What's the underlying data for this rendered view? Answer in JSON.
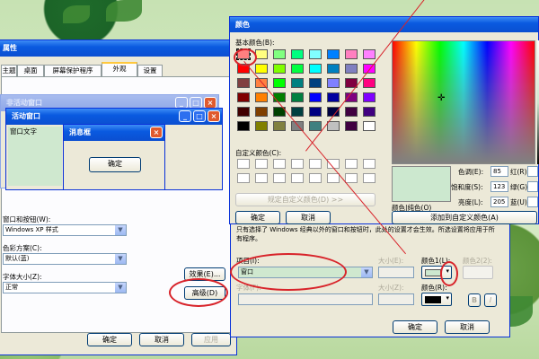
{
  "props_window": {
    "title": "属性",
    "tabs": [
      "主题",
      "桌面",
      "屏幕保护程序",
      "外观",
      "设置"
    ],
    "labels": {
      "window_buttons": "窗口和按钮(W):",
      "color_scheme": "色彩方案(C):",
      "font_size": "字体大小(Z):"
    },
    "values": {
      "window_buttons": "Windows XP 样式",
      "color_scheme": "默认(蓝)",
      "font_size": "正常"
    },
    "buttons": {
      "effects": "效果(E)...",
      "advanced": "高级(D)",
      "ok": "确定",
      "cancel": "取消",
      "apply": "应用"
    }
  },
  "preview": {
    "inactive_title": "非活动窗口",
    "active_title": "活动窗口",
    "window_text": "窗口文字",
    "msgbox_title": "消息框",
    "msgbox_ok": "确定"
  },
  "advanced": {
    "note": "只有选择了 Windows 经典以外的窗口和按钮时，此处的设置才会生效。所选设置将应用于所有程序。",
    "project_label": "项目(I):",
    "project_value": "窗口",
    "size_label": "大小(E):",
    "color1_label": "颜色1(L):",
    "color2_label": "颜色2(2):",
    "font_label": "字体(F):",
    "font_size_label": "大小(Z):",
    "font_color_label": "颜色(R):",
    "bold": "B",
    "italic": "I",
    "ok": "确定",
    "cancel": "取消"
  },
  "color_dialog": {
    "title": "颜色",
    "basic_colors_label": "基本颜色(B):",
    "custom_colors_label": "自定义颜色(C):",
    "define_custom": "规定自定义颜色(D) >>",
    "ok": "确定",
    "cancel": "取消",
    "add_custom": "添加到自定义颜色(A)",
    "color_solid": "颜色|纯色(O)",
    "hue_label": "色调(E):",
    "hue": "85",
    "sat_label": "饱和度(S):",
    "sat": "123",
    "lum_label": "亮度(L):",
    "lum": "205",
    "red_label": "红(R):",
    "red": "",
    "green_label": "绿(G):",
    "green": "",
    "blue_label": "蓝(U):",
    "blue": "",
    "selected_color": "#cce8cf",
    "basic_colors": [
      "#ff8080",
      "#ffff80",
      "#80ff80",
      "#00ff80",
      "#80ffff",
      "#0080ff",
      "#ff80c0",
      "#ff80ff",
      "#ff0000",
      "#ffff00",
      "#80ff00",
      "#00ff40",
      "#00ffff",
      "#0080c0",
      "#8080c0",
      "#ff00ff",
      "#804040",
      "#ff8040",
      "#00ff00",
      "#008080",
      "#004080",
      "#8080ff",
      "#800040",
      "#ff0080",
      "#800000",
      "#ff8000",
      "#008000",
      "#008040",
      "#0000ff",
      "#0000a0",
      "#800080",
      "#8000ff",
      "#400000",
      "#804000",
      "#004000",
      "#004040",
      "#000080",
      "#000040",
      "#400040",
      "#400080",
      "#000000",
      "#808000",
      "#808040",
      "#808080",
      "#408080",
      "#c0c0c0",
      "#400040",
      "#ffffff"
    ]
  }
}
